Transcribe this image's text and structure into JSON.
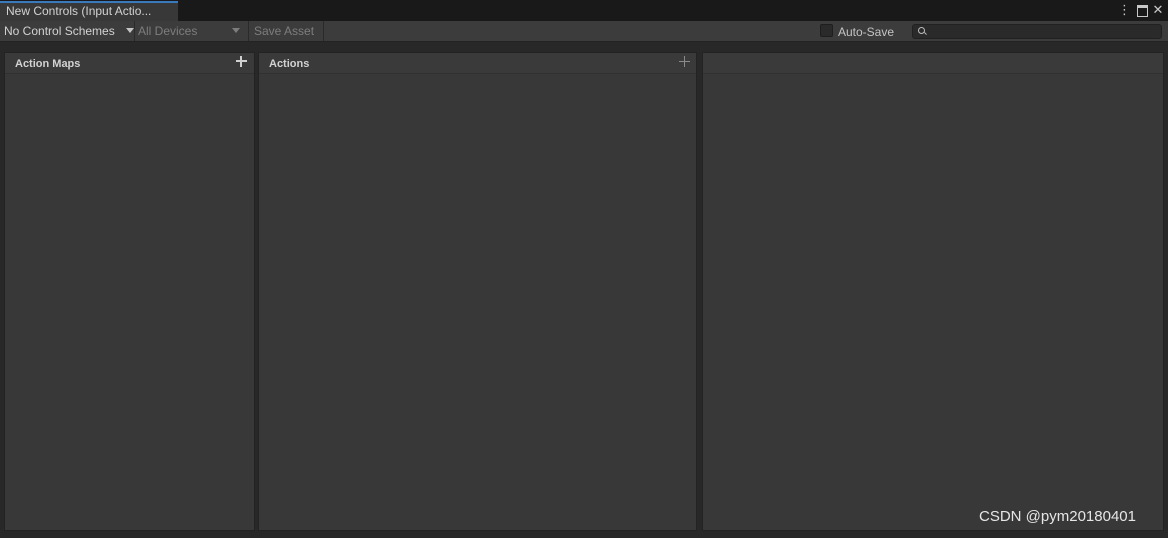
{
  "tab": {
    "title": "New Controls (Input Actio..."
  },
  "window_controls": {
    "menu_icon": "vertical-dots-icon",
    "maximize_icon": "maximize-icon",
    "close_icon": "close-icon",
    "menu_glyph": "⋮",
    "maximize_glyph": "▢",
    "close_glyph": "✕"
  },
  "toolbar": {
    "control_schemes": "No Control Schemes",
    "devices": "All Devices",
    "save_asset": "Save Asset",
    "auto_save_label": "Auto-Save",
    "search_placeholder": ""
  },
  "panels": {
    "action_maps": {
      "title": "Action Maps"
    },
    "actions": {
      "title": "Actions"
    },
    "properties": {
      "title": ""
    }
  },
  "watermark": "CSDN @pym20180401",
  "colors": {
    "accent_tab": "#3a79bb",
    "panel_bg": "#383838",
    "toolbar_bg": "#3c3c3c",
    "window_bg": "#282828"
  }
}
